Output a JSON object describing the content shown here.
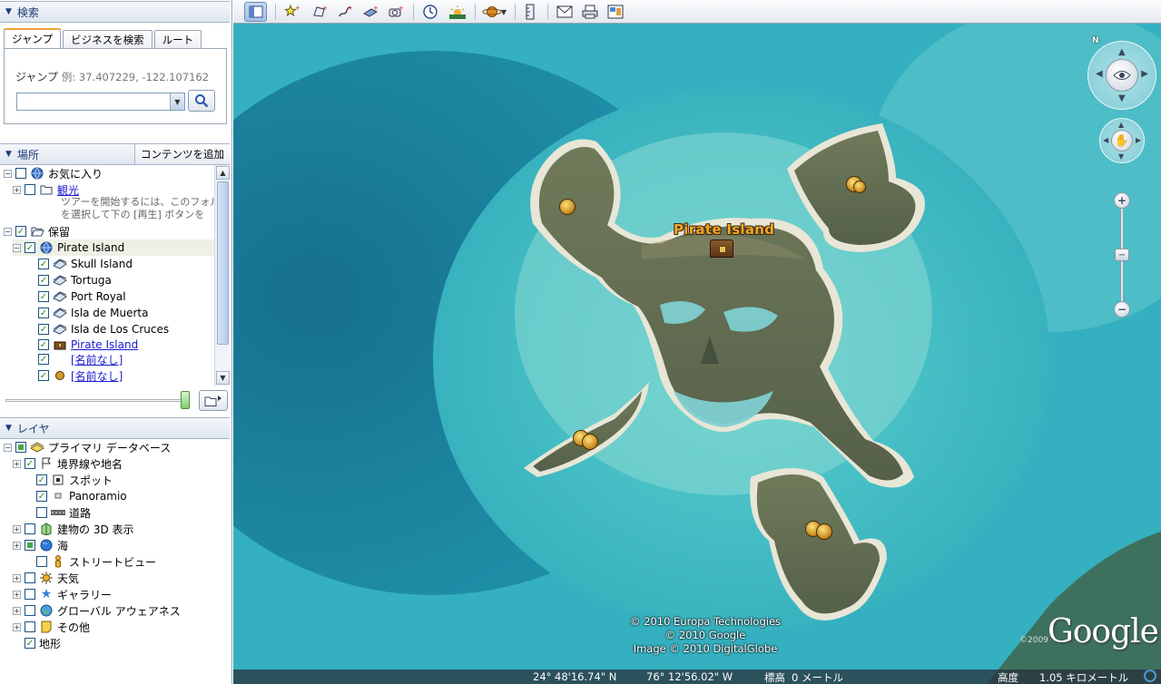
{
  "search": {
    "header": "検索",
    "tabs": [
      "ジャンプ",
      "ビジネスを検索",
      "ルート"
    ],
    "jump_label": "ジャンプ",
    "jump_example": "例: 37.407229, -122.107162",
    "jump_value": ""
  },
  "places": {
    "header": "場所",
    "add_content": "コンテンツを追加",
    "favorites": "お気に入り",
    "sightseeing": "観光",
    "sightseeing_desc1": "ツアーを開始するには、このフォル",
    "sightseeing_desc2": "を選択して下の [再生] ボタンを",
    "temporary": "保留",
    "pirate_island": "Pirate Island",
    "items": [
      "Skull Island",
      "Tortuga",
      "Port Royal",
      "Isla de Muerta",
      "Isla de Los Cruces"
    ],
    "pirate_island_link": "Pirate Island",
    "unnamed1": "[名前なし]",
    "unnamed2": "[名前なし]"
  },
  "layers": {
    "header": "レイヤ",
    "primary_db": "プライマリ データベース",
    "items": [
      "境界線や地名",
      "スポット",
      "Panoramio",
      "道路",
      "建物の 3D 表示",
      "海",
      "ストリートビュー",
      "天気",
      "ギャラリー",
      "グローバル アウェアネス",
      "その他",
      "地形"
    ]
  },
  "map": {
    "placemark_label": "Pirate Island",
    "copyright_lines": [
      "© 2010 Europa Technologies",
      "© 2010 Google",
      "Image © 2010 DigitalGlobe"
    ],
    "google_logo": "Google",
    "google_year": "©2009",
    "compass_n": "N"
  },
  "status": {
    "lat": "24° 48'16.74\" N",
    "lon": "76° 12'56.02\" W",
    "elev_label": "標高",
    "elev_value": "0 メートル",
    "alt_label": "高度",
    "alt_value": "1.05 キロメートル"
  }
}
